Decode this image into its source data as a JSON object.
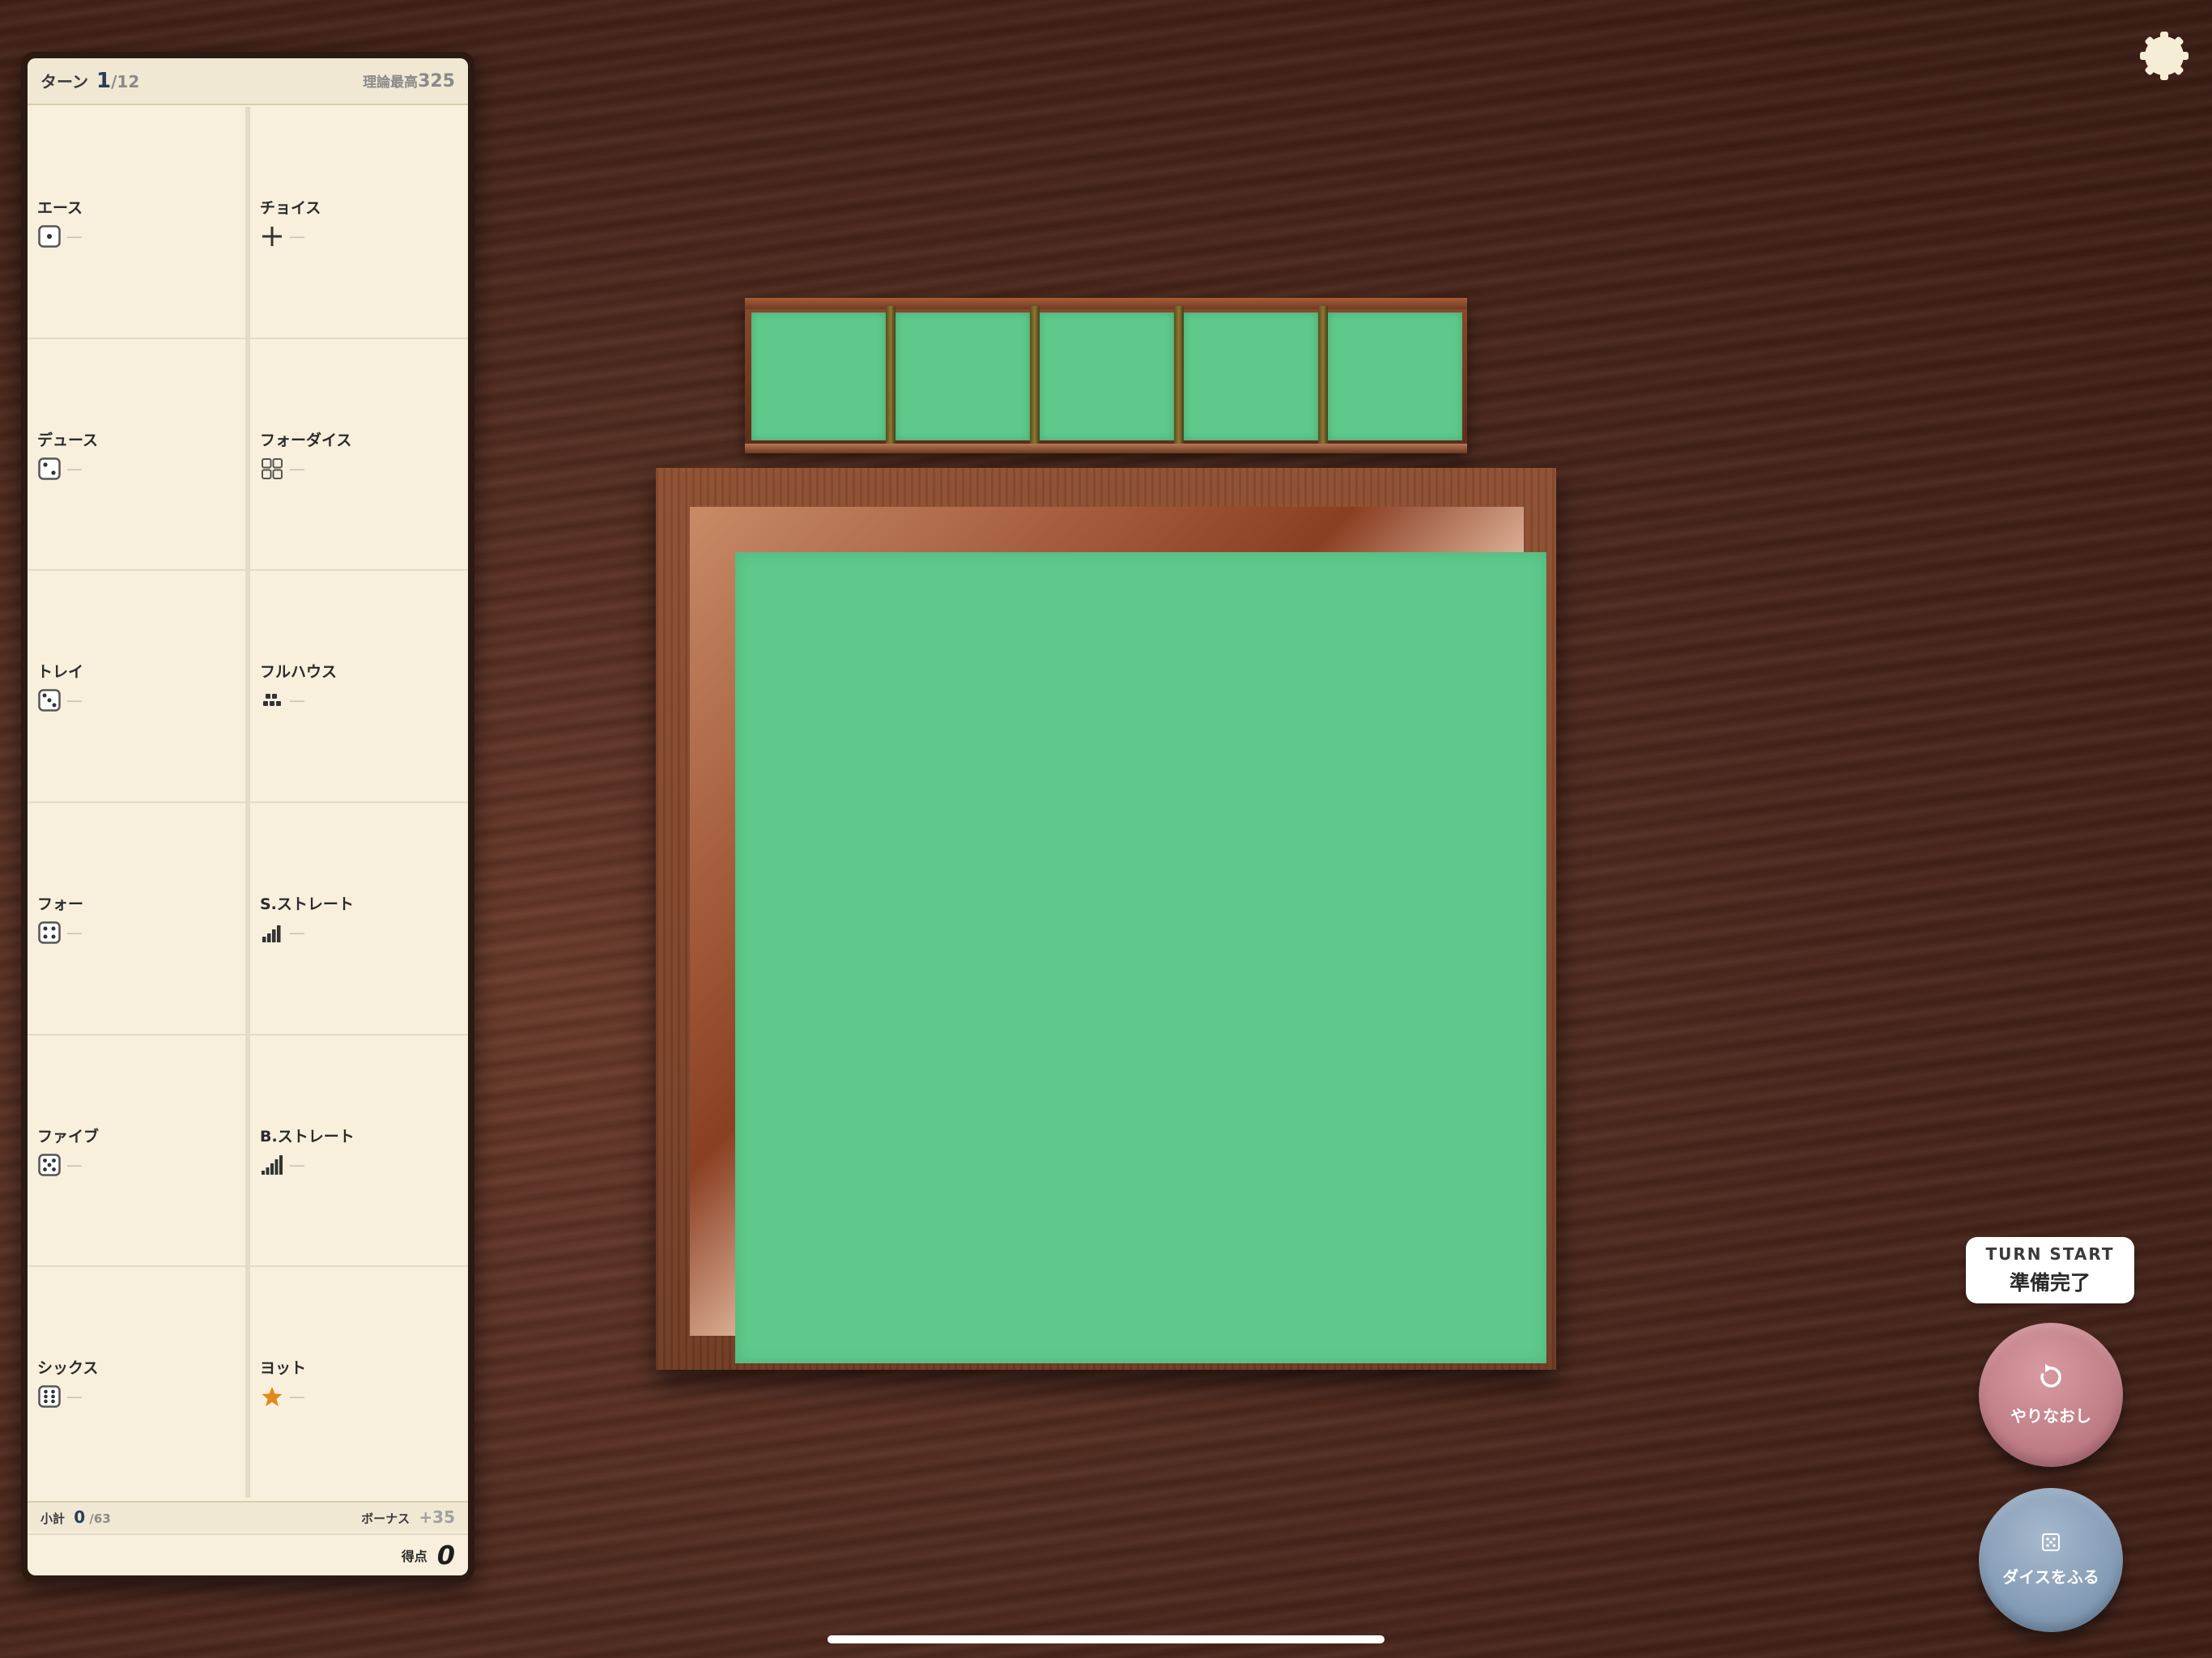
{
  "scoresheet": {
    "turn_label": "ターン",
    "turn_current": "1",
    "turn_total": "/12",
    "max_label": "理論最高",
    "max_value": "325",
    "categories": [
      {
        "label": "エース",
        "icon": "die-one-icon",
        "score": "—"
      },
      {
        "label": "チョイス",
        "icon": "plus-icon",
        "score": "—"
      },
      {
        "label": "デュース",
        "icon": "die-two-icon",
        "score": "—"
      },
      {
        "label": "フォーダイス",
        "icon": "four-squares-icon",
        "score": "—"
      },
      {
        "label": "トレイ",
        "icon": "die-three-icon",
        "score": "—"
      },
      {
        "label": "フルハウス",
        "icon": "full-house-icon",
        "score": "—"
      },
      {
        "label": "フォー",
        "icon": "die-four-icon",
        "score": "—"
      },
      {
        "label": "S.ストレート",
        "icon": "small-straight-bars-icon",
        "score": "—"
      },
      {
        "label": "ファイブ",
        "icon": "die-five-icon",
        "score": "—"
      },
      {
        "label": "B.ストレート",
        "icon": "big-straight-bars-icon",
        "score": "—"
      },
      {
        "label": "シックス",
        "icon": "die-six-icon",
        "score": "—"
      },
      {
        "label": "ヨット",
        "icon": "star-icon",
        "score": "—"
      }
    ],
    "subtotal_label": "小計",
    "subtotal_value": "0",
    "subtotal_target": "/63",
    "bonus_label": "ボーナス",
    "bonus_value": "+35",
    "score_label": "得点",
    "score_value": "0"
  },
  "rack": {
    "slots": 5
  },
  "controls": {
    "settings_icon": "gear-icon",
    "turn_card_en": "TURN START",
    "turn_card_jp": "準備完了",
    "redo_label": "やりなおし",
    "redo_icon": "rotate-icon",
    "roll_label": "ダイスをふる",
    "roll_icon": "die-icon"
  },
  "colors": {
    "felt": "#5ec98b",
    "sheet": "#f8f0dc",
    "redo_button": "#c27f88",
    "roll_button": "#8aa1ba",
    "star": "#e08a1a"
  }
}
